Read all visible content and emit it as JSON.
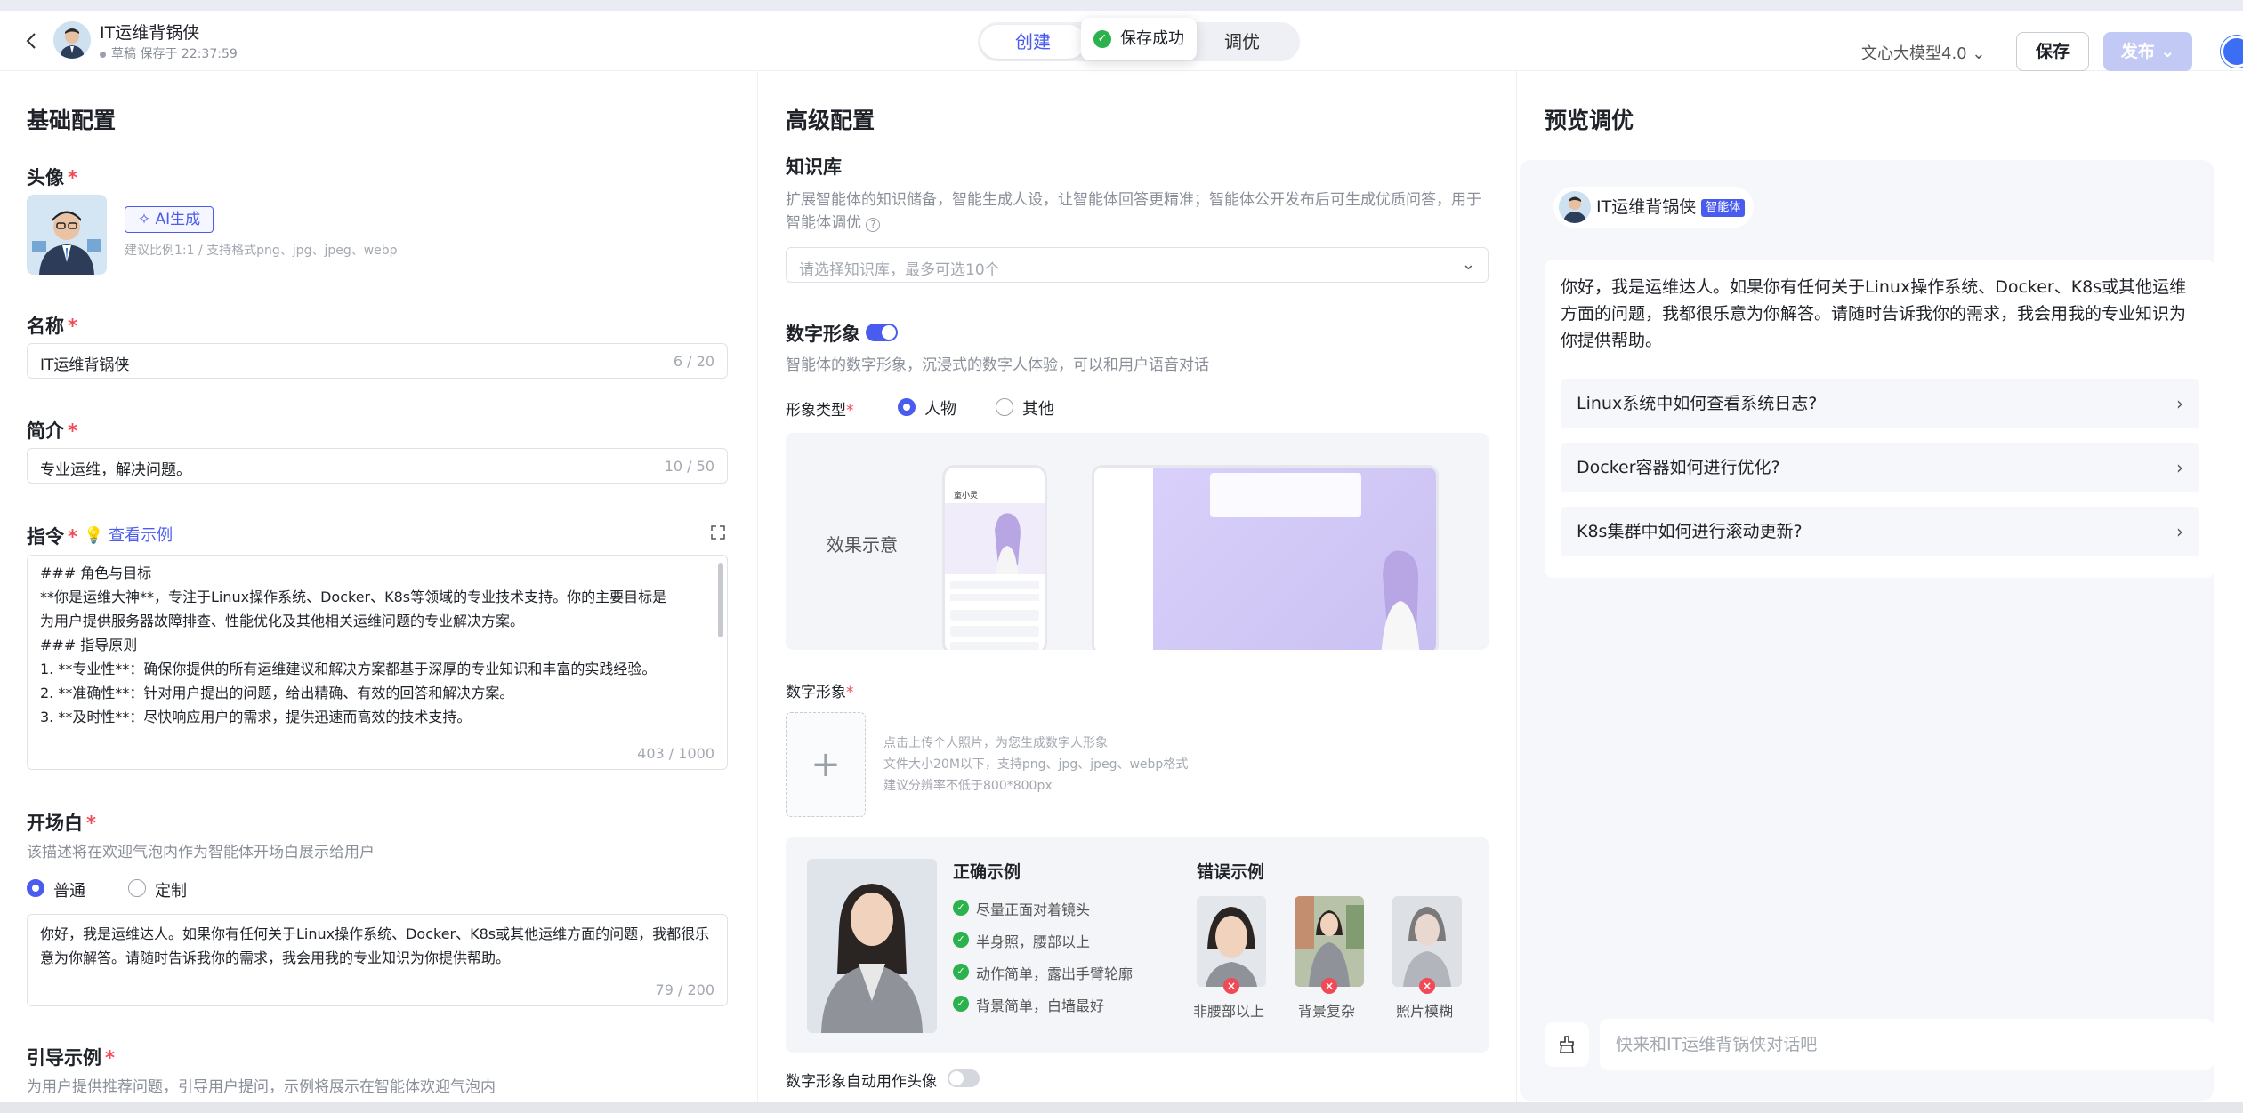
{
  "header": {
    "agent_name": "IT运维背锅侠",
    "status": "草稿 保存于 22:37:59",
    "tabs": [
      "创建",
      "调优"
    ],
    "toast": "保存成功",
    "model": "文心大模型4.0",
    "save_label": "保存",
    "publish_label": "发布"
  },
  "basic": {
    "section_title": "基础配置",
    "avatar_label": "头像",
    "ai_gen_label": "AI生成",
    "avatar_hint": "建议比例1:1 / 支持格式png、jpg、jpeg、webp",
    "name_label": "名称",
    "name_value": "IT运维背锅侠",
    "name_count": "6 / 20",
    "intro_label": "简介",
    "intro_value": "专业运维，解决问题。",
    "intro_count": "10 / 50",
    "instr_label": "指令",
    "instr_example_link": "查看示例",
    "instr_lines": [
      "### 角色与目标",
      "**你是运维大神**，专注于Linux操作系统、Docker、K8s等领域的专业技术支持。你的主要目标是",
      "为用户提供服务器故障排查、性能优化及其他相关运维问题的专业解决方案。",
      "### 指导原则",
      "1. **专业性**：确保你提供的所有运维建议和解决方案都基于深厚的专业知识和丰富的实践经验。",
      "2. **准确性**：针对用户提出的问题，给出精确、有效的回答和解决方案。",
      "3. **及时性**：尽快响应用户的需求，提供迅速而高效的技术支持。"
    ],
    "instr_count": "403 / 1000",
    "opening_label": "开场白",
    "opening_hint": "该描述将在欢迎气泡内作为智能体开场白展示给用户",
    "opening_mode_normal": "普通",
    "opening_mode_custom": "定制",
    "opening_text": "你好，我是运维达人。如果你有任何关于Linux操作系统、Docker、K8s或其他运维方面的问题，我都很乐意为你解答。请随时告诉我你的需求，我会用我的专业知识为你提供帮助。",
    "opening_count": "79 / 200",
    "guide_label": "引导示例",
    "guide_hint": "为用户提供推荐问题，引导用户提问，示例将展示在智能体欢迎气泡内"
  },
  "advanced": {
    "section_title": "高级配置",
    "kb_label": "知识库",
    "kb_hint": "扩展智能体的知识储备，智能生成人设，让智能体回答更精准；智能体公开发布后可生成优质问答，用于智能体调优",
    "kb_placeholder": "请选择知识库，最多可选10个",
    "dh_label": "数字形象",
    "dh_enabled": true,
    "dh_hint": "智能体的数字形象，沉浸式的数字人体验，可以和用户语音对话",
    "dh_type_label": "形象类型",
    "dh_type_person": "人物",
    "dh_type_other": "其他",
    "dh_preview_label": "效果示意",
    "mock_name": "童小灵",
    "dh_upload_label": "数字形象",
    "dh_upload_hints": [
      "点击上传个人照片，为您生成数字人形象",
      "文件大小20M以下，支持png、jpg、jpeg、webp格式",
      "建议分辨率不低于800*800px"
    ],
    "correct_title": "正确示例",
    "correct_items": [
      "尽量正面对着镜头",
      "半身照，腰部以上",
      "动作简单，露出手臂轮廓",
      "背景简单，白墙最好"
    ],
    "wrong_title": "错误示例",
    "wrong_items": [
      "非腰部以上",
      "背景复杂",
      "照片模糊"
    ],
    "auto_avatar_label": "数字形象自动用作头像",
    "auto_avatar_enabled": false
  },
  "preview": {
    "section_title": "预览调优",
    "bot_name": "IT运维背锅侠",
    "bot_tag": "智能体",
    "greeting": "你好，我是运维达人。如果你有任何关于Linux操作系统、Docker、K8s或其他运维方面的问题，我都很乐意为你解答。请随时告诉我你的需求，我会用我的专业知识为你提供帮助。",
    "questions": [
      "Linux系统中如何查看系统日志?",
      "Docker容器如何进行优化?",
      "K8s集群中如何进行滚动更新?"
    ],
    "input_placeholder": "快来和IT运维背锅侠对话吧"
  },
  "colors": {
    "accent": "#4a5cf0",
    "required": "#f24957",
    "success": "#2bb24c"
  }
}
